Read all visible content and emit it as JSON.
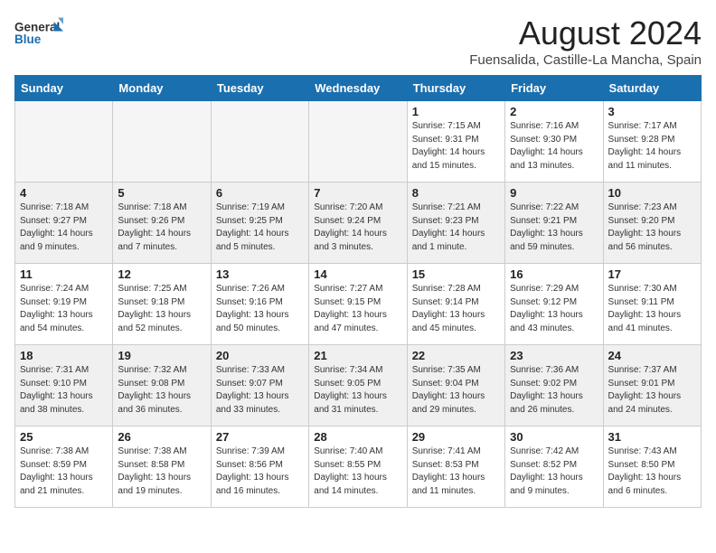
{
  "header": {
    "logo_line1": "General",
    "logo_line2": "Blue",
    "title": "August 2024",
    "subtitle": "Fuensalida, Castille-La Mancha, Spain"
  },
  "weekdays": [
    "Sunday",
    "Monday",
    "Tuesday",
    "Wednesday",
    "Thursday",
    "Friday",
    "Saturday"
  ],
  "weeks": [
    [
      {
        "day": "",
        "info": "",
        "empty": true
      },
      {
        "day": "",
        "info": "",
        "empty": true
      },
      {
        "day": "",
        "info": "",
        "empty": true
      },
      {
        "day": "",
        "info": "",
        "empty": true
      },
      {
        "day": "1",
        "info": "Sunrise: 7:15 AM\nSunset: 9:31 PM\nDaylight: 14 hours\nand 15 minutes."
      },
      {
        "day": "2",
        "info": "Sunrise: 7:16 AM\nSunset: 9:30 PM\nDaylight: 14 hours\nand 13 minutes."
      },
      {
        "day": "3",
        "info": "Sunrise: 7:17 AM\nSunset: 9:28 PM\nDaylight: 14 hours\nand 11 minutes."
      }
    ],
    [
      {
        "day": "4",
        "info": "Sunrise: 7:18 AM\nSunset: 9:27 PM\nDaylight: 14 hours\nand 9 minutes."
      },
      {
        "day": "5",
        "info": "Sunrise: 7:18 AM\nSunset: 9:26 PM\nDaylight: 14 hours\nand 7 minutes."
      },
      {
        "day": "6",
        "info": "Sunrise: 7:19 AM\nSunset: 9:25 PM\nDaylight: 14 hours\nand 5 minutes."
      },
      {
        "day": "7",
        "info": "Sunrise: 7:20 AM\nSunset: 9:24 PM\nDaylight: 14 hours\nand 3 minutes."
      },
      {
        "day": "8",
        "info": "Sunrise: 7:21 AM\nSunset: 9:23 PM\nDaylight: 14 hours\nand 1 minute."
      },
      {
        "day": "9",
        "info": "Sunrise: 7:22 AM\nSunset: 9:21 PM\nDaylight: 13 hours\nand 59 minutes."
      },
      {
        "day": "10",
        "info": "Sunrise: 7:23 AM\nSunset: 9:20 PM\nDaylight: 13 hours\nand 56 minutes."
      }
    ],
    [
      {
        "day": "11",
        "info": "Sunrise: 7:24 AM\nSunset: 9:19 PM\nDaylight: 13 hours\nand 54 minutes."
      },
      {
        "day": "12",
        "info": "Sunrise: 7:25 AM\nSunset: 9:18 PM\nDaylight: 13 hours\nand 52 minutes."
      },
      {
        "day": "13",
        "info": "Sunrise: 7:26 AM\nSunset: 9:16 PM\nDaylight: 13 hours\nand 50 minutes."
      },
      {
        "day": "14",
        "info": "Sunrise: 7:27 AM\nSunset: 9:15 PM\nDaylight: 13 hours\nand 47 minutes."
      },
      {
        "day": "15",
        "info": "Sunrise: 7:28 AM\nSunset: 9:14 PM\nDaylight: 13 hours\nand 45 minutes."
      },
      {
        "day": "16",
        "info": "Sunrise: 7:29 AM\nSunset: 9:12 PM\nDaylight: 13 hours\nand 43 minutes."
      },
      {
        "day": "17",
        "info": "Sunrise: 7:30 AM\nSunset: 9:11 PM\nDaylight: 13 hours\nand 41 minutes."
      }
    ],
    [
      {
        "day": "18",
        "info": "Sunrise: 7:31 AM\nSunset: 9:10 PM\nDaylight: 13 hours\nand 38 minutes."
      },
      {
        "day": "19",
        "info": "Sunrise: 7:32 AM\nSunset: 9:08 PM\nDaylight: 13 hours\nand 36 minutes."
      },
      {
        "day": "20",
        "info": "Sunrise: 7:33 AM\nSunset: 9:07 PM\nDaylight: 13 hours\nand 33 minutes."
      },
      {
        "day": "21",
        "info": "Sunrise: 7:34 AM\nSunset: 9:05 PM\nDaylight: 13 hours\nand 31 minutes."
      },
      {
        "day": "22",
        "info": "Sunrise: 7:35 AM\nSunset: 9:04 PM\nDaylight: 13 hours\nand 29 minutes."
      },
      {
        "day": "23",
        "info": "Sunrise: 7:36 AM\nSunset: 9:02 PM\nDaylight: 13 hours\nand 26 minutes."
      },
      {
        "day": "24",
        "info": "Sunrise: 7:37 AM\nSunset: 9:01 PM\nDaylight: 13 hours\nand 24 minutes."
      }
    ],
    [
      {
        "day": "25",
        "info": "Sunrise: 7:38 AM\nSunset: 8:59 PM\nDaylight: 13 hours\nand 21 minutes."
      },
      {
        "day": "26",
        "info": "Sunrise: 7:38 AM\nSunset: 8:58 PM\nDaylight: 13 hours\nand 19 minutes."
      },
      {
        "day": "27",
        "info": "Sunrise: 7:39 AM\nSunset: 8:56 PM\nDaylight: 13 hours\nand 16 minutes."
      },
      {
        "day": "28",
        "info": "Sunrise: 7:40 AM\nSunset: 8:55 PM\nDaylight: 13 hours\nand 14 minutes."
      },
      {
        "day": "29",
        "info": "Sunrise: 7:41 AM\nSunset: 8:53 PM\nDaylight: 13 hours\nand 11 minutes."
      },
      {
        "day": "30",
        "info": "Sunrise: 7:42 AM\nSunset: 8:52 PM\nDaylight: 13 hours\nand 9 minutes."
      },
      {
        "day": "31",
        "info": "Sunrise: 7:43 AM\nSunset: 8:50 PM\nDaylight: 13 hours\nand 6 minutes."
      }
    ]
  ],
  "colors": {
    "header_bg": "#1a6faf",
    "accent": "#1a6faf",
    "empty_bg": "#f5f5f5",
    "row_shaded": "#f0f0f0"
  }
}
